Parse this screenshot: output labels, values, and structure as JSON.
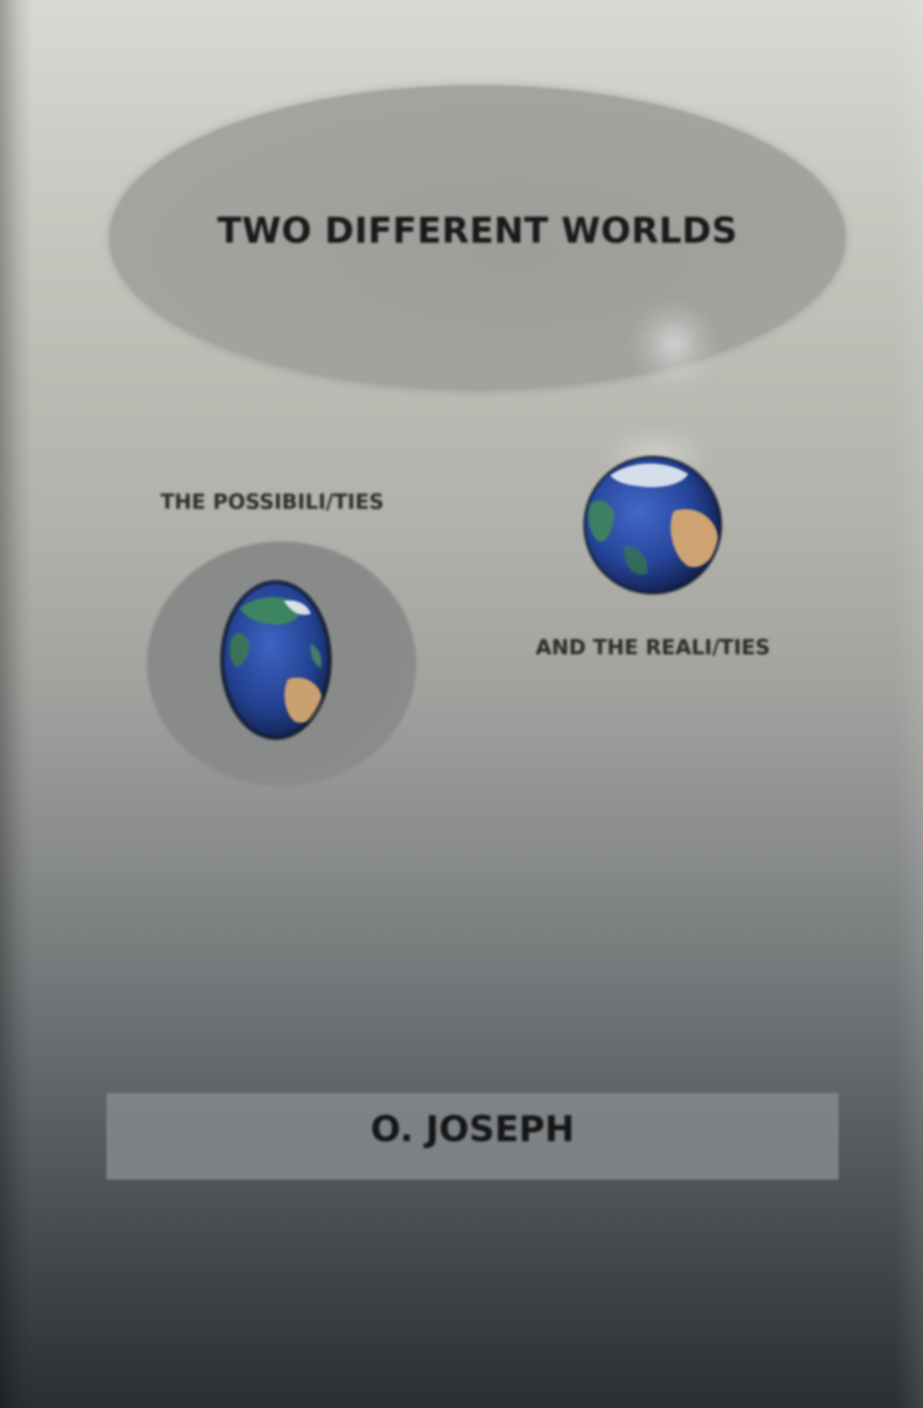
{
  "cover": {
    "title": "TWO DIFFERENT WORLDS",
    "subtitle_left": "THE POSSIBILI/TIES",
    "subtitle_right": "AND THE REALI/TIES",
    "author": "O. JOSEPH"
  },
  "icons": {
    "globe_left": "earth-globe-icon",
    "globe_right": "earth-globe-icon"
  },
  "colors": {
    "ocean": "#2f4fa0",
    "land": "#c89a6a",
    "text": "#1a1a1a"
  }
}
